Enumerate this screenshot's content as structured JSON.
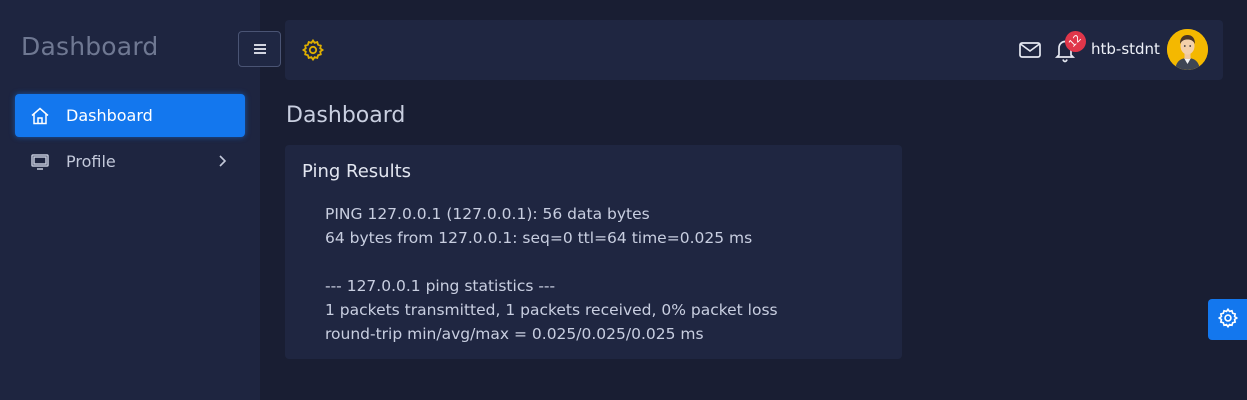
{
  "sidebar": {
    "brand": "Dashboard",
    "items": [
      {
        "label": "Dashboard",
        "icon": "home-icon",
        "active": true
      },
      {
        "label": "Profile",
        "icon": "monitor-icon",
        "active": false
      }
    ]
  },
  "topbar": {
    "notification_count": "12",
    "username": "htb-stdnt"
  },
  "main": {
    "page_title": "Dashboard",
    "card": {
      "title": "Ping Results",
      "lines": [
        "PING 127.0.0.1 (127.0.0.1): 56 data bytes",
        "64 bytes from 127.0.0.1: seq=0 ttl=64 time=0.025 ms",
        "",
        "--- 127.0.0.1 ping statistics ---",
        "1 packets transmitted, 1 packets received, 0% packet loss",
        "round-trip min/avg/max = 0.025/0.025/0.025 ms"
      ]
    }
  },
  "colors": {
    "accent": "#1377ee",
    "gear": "#e0b000",
    "badge": "#e0364a",
    "background": "#191e33",
    "panel": "#1f2641"
  }
}
